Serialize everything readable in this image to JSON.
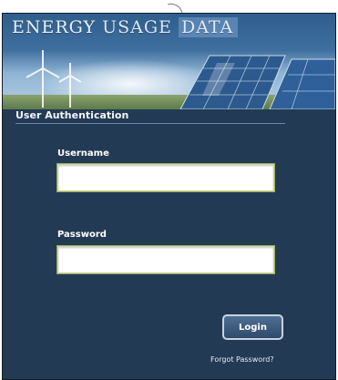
{
  "header": {
    "title_word_1": "ENERGY",
    "title_word_2": "USAGE",
    "title_word_3": "DATA"
  },
  "auth": {
    "section_title": "User Authentication",
    "username_label": "Username",
    "username_value": "",
    "password_label": "Password",
    "password_value": "",
    "login_label": "Login",
    "forgot_label": "Forgot Password?"
  },
  "colors": {
    "panel_background": "#233a55",
    "input_border": "#9aac5c",
    "button_border": "#c8d3df"
  },
  "icons": [
    "wind-turbine-icon",
    "solar-panel-icon"
  ]
}
